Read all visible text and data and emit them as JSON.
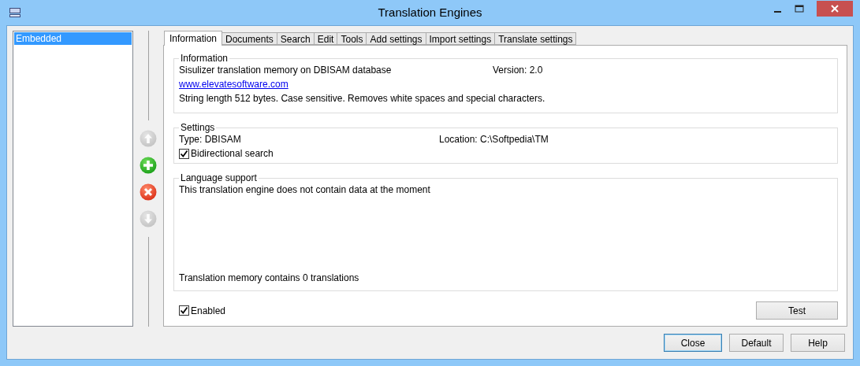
{
  "window": {
    "title": "Translation Engines"
  },
  "engines": [
    {
      "label": "Embedded",
      "selected": true
    }
  ],
  "side_buttons": [
    {
      "kind": "up",
      "disabled": true
    },
    {
      "kind": "add",
      "disabled": false
    },
    {
      "kind": "remove",
      "disabled": false
    },
    {
      "kind": "down",
      "disabled": true
    }
  ],
  "tabs": [
    {
      "label": "Information",
      "selected": true
    },
    {
      "label": "Documents",
      "selected": false
    },
    {
      "label": "Search",
      "selected": false
    },
    {
      "label": "Edit",
      "selected": false
    },
    {
      "label": "Tools",
      "selected": false
    },
    {
      "label": "Add settings",
      "selected": false
    },
    {
      "label": "Import settings",
      "selected": false
    },
    {
      "label": "Translate settings",
      "selected": false
    }
  ],
  "information": {
    "title": "Information",
    "description": "Sisulizer translation memory on DBISAM database",
    "version": "Version: 2.0",
    "link": "www.elevatesoftware.com",
    "details": "String length 512 bytes. Case sensitive. Removes white spaces and special characters."
  },
  "settings": {
    "title": "Settings",
    "type": "Type: DBISAM",
    "location": "Location: C:\\Softpedia\\TM",
    "bidirectional": {
      "label": "Bidirectional search",
      "checked": true
    }
  },
  "language_support": {
    "title": "Language support",
    "message": "This translation engine does not contain data at the moment",
    "footer": "Translation memory contains 0 translations"
  },
  "enabled": {
    "label": "Enabled",
    "checked": true
  },
  "test_button": "Test",
  "buttons": [
    {
      "label": "Close",
      "default": true
    },
    {
      "label": "Default",
      "default": false
    },
    {
      "label": "Help",
      "default": false
    }
  ]
}
